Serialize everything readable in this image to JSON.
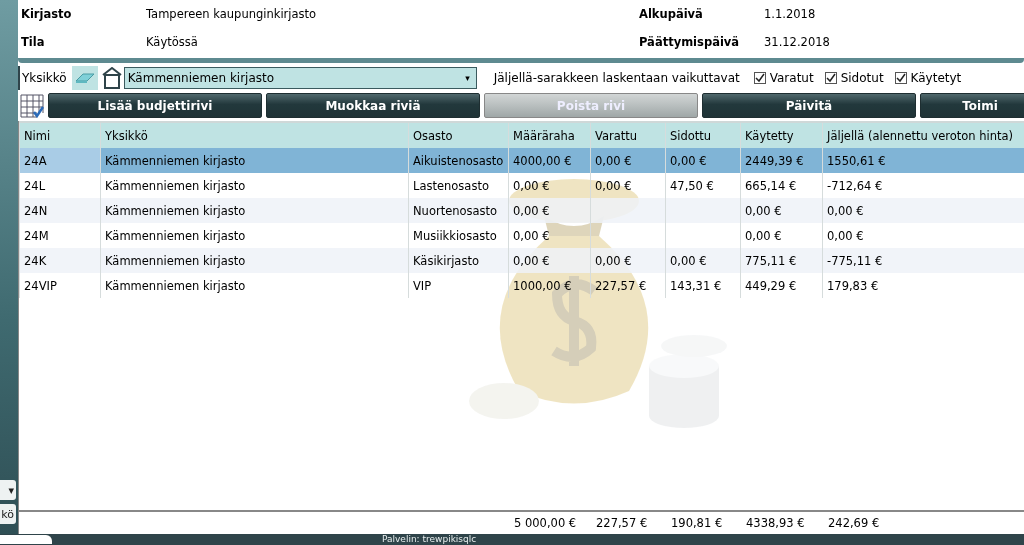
{
  "side_strip": {
    "caret": "▾",
    "tab_fragment": "kö"
  },
  "info": [
    {
      "label": "Kirjasto",
      "value": "Tampereen kaupunginkirjasto"
    },
    {
      "label": "Tila",
      "value": "Käytössä"
    },
    {
      "label": "Alkupäivä",
      "value": "1.1.2018"
    },
    {
      "label": "Päättymispäivä",
      "value": "31.12.2018"
    }
  ],
  "unit_bar": {
    "label": "Yksikkö",
    "dropdown_value": "Kämmenniemen kirjasto",
    "caret": "▾",
    "affects_label": "Jäljellä-sarakkeen laskentaan vaikuttavat",
    "checkboxes": [
      {
        "label": "Varatut",
        "checked": true
      },
      {
        "label": "Sidotut",
        "checked": true
      },
      {
        "label": "Käytetyt",
        "checked": true
      }
    ]
  },
  "buttons": [
    {
      "label": "Lisää budjettirivi",
      "disabled": false
    },
    {
      "label": "Muokkaa riviä",
      "disabled": false
    },
    {
      "label": "Poista rivi",
      "disabled": true
    },
    {
      "label": "Päivitä",
      "disabled": false
    },
    {
      "label": "Toimi",
      "disabled": false
    }
  ],
  "table": {
    "columns": [
      "Nimi",
      "Yksikkö",
      "Osasto",
      "Määräraha",
      "Varattu",
      "Sidottu",
      "Käytetty",
      "Jäljellä (alennettu veroton hinta)"
    ],
    "rows": [
      {
        "selected": true,
        "cells": [
          "24A",
          "Kämmenniemen kirjasto",
          "Aikuistenosasto",
          "4000,00 €",
          "0,00 €",
          "0,00 €",
          "2449,39 €",
          "1550,61 €"
        ]
      },
      {
        "selected": false,
        "cells": [
          "24L",
          "Kämmenniemen kirjasto",
          "Lastenosasto",
          "0,00 €",
          "0,00 €",
          "47,50 €",
          "665,14 €",
          "-712,64 €"
        ]
      },
      {
        "selected": false,
        "cells": [
          "24N",
          "Kämmenniemen kirjasto",
          "Nuortenosasto",
          "0,00 €",
          "",
          "",
          "0,00 €",
          "0,00 €"
        ]
      },
      {
        "selected": false,
        "cells": [
          "24M",
          "Kämmenniemen kirjasto",
          "Musiikkiosasto",
          "0,00 €",
          "",
          "",
          "0,00 €",
          "0,00 €"
        ]
      },
      {
        "selected": false,
        "cells": [
          "24K",
          "Kämmenniemen kirjasto",
          "Käsikirjasto",
          "0,00 €",
          "0,00 €",
          "0,00 €",
          "775,11 €",
          "-775,11 €"
        ]
      },
      {
        "selected": false,
        "cells": [
          "24VIP",
          "Kämmenniemen kirjasto",
          "VIP",
          "1000,00 €",
          "227,57 €",
          "143,31 €",
          "449,29 €",
          "179,83 €"
        ]
      }
    ],
    "totals": [
      "5 000,00 €",
      "227,57 €",
      "190,81 €",
      "4338,93 €",
      "242,69 €"
    ]
  },
  "status_bar": {
    "text": "Palvelin: trewpikisqlc"
  }
}
